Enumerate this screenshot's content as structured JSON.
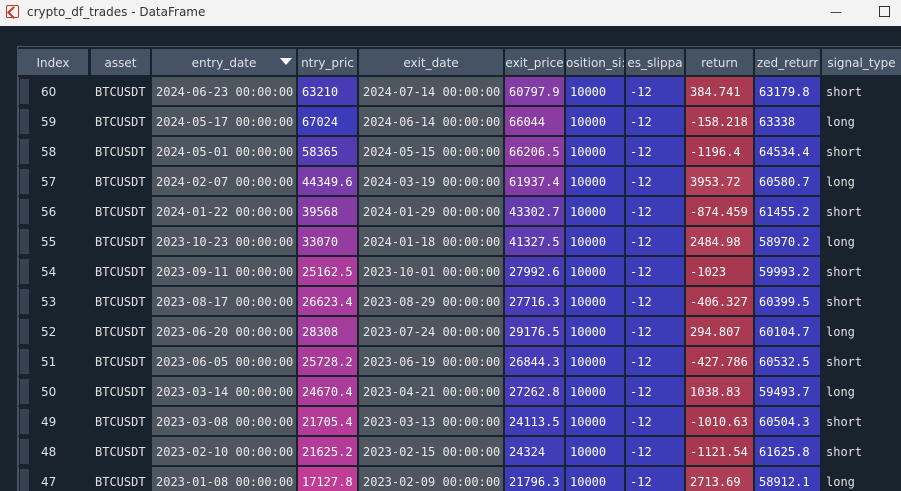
{
  "window": {
    "title": "crypto_df_trades - DataFrame",
    "minimize_label": "—"
  },
  "columns": [
    {
      "key": "index",
      "label": "Index"
    },
    {
      "key": "asset",
      "label": "asset"
    },
    {
      "key": "entry_date",
      "label": "entry_date",
      "sort": "descending"
    },
    {
      "key": "entry_price",
      "label": "ntry_pric"
    },
    {
      "key": "exit_date",
      "label": "exit_date"
    },
    {
      "key": "exit_price",
      "label": "exit_price"
    },
    {
      "key": "position_size",
      "label": "osition_si:"
    },
    {
      "key": "slippage",
      "label": "es_slippa"
    },
    {
      "key": "return",
      "label": "return"
    },
    {
      "key": "cum_return",
      "label": "zed_returr"
    },
    {
      "key": "signal_type",
      "label": "signal_type"
    }
  ],
  "rows": [
    {
      "index": "60",
      "asset": "BTCUSDT",
      "entry_date": "2024-06-23 00:00:00",
      "entry_price": "63210",
      "exit_date": "2024-07-14 00:00:00",
      "exit_price": "60797.9",
      "position_size": "10000",
      "slippage": "-12",
      "return": "384.741",
      "cum_return": "63179.8",
      "signal_type": "short"
    },
    {
      "index": "59",
      "asset": "BTCUSDT",
      "entry_date": "2024-05-17 00:00:00",
      "entry_price": "67024",
      "exit_date": "2024-06-14 00:00:00",
      "exit_price": "66044",
      "position_size": "10000",
      "slippage": "-12",
      "return": "-158.218",
      "cum_return": "63338",
      "signal_type": "long"
    },
    {
      "index": "58",
      "asset": "BTCUSDT",
      "entry_date": "2024-05-01 00:00:00",
      "entry_price": "58365",
      "exit_date": "2024-05-15 00:00:00",
      "exit_price": "66206.5",
      "position_size": "10000",
      "slippage": "-12",
      "return": "-1196.4",
      "cum_return": "64534.4",
      "signal_type": "short"
    },
    {
      "index": "57",
      "asset": "BTCUSDT",
      "entry_date": "2024-02-07 00:00:00",
      "entry_price": "44349.6",
      "exit_date": "2024-03-19 00:00:00",
      "exit_price": "61937.4",
      "position_size": "10000",
      "slippage": "-12",
      "return": "3953.72",
      "cum_return": "60580.7",
      "signal_type": "long"
    },
    {
      "index": "56",
      "asset": "BTCUSDT",
      "entry_date": "2024-01-22 00:00:00",
      "entry_price": "39568",
      "exit_date": "2024-01-29 00:00:00",
      "exit_price": "43302.7",
      "position_size": "10000",
      "slippage": "-12",
      "return": "-874.459",
      "cum_return": "61455.2",
      "signal_type": "short"
    },
    {
      "index": "55",
      "asset": "BTCUSDT",
      "entry_date": "2023-10-23 00:00:00",
      "entry_price": "33070",
      "exit_date": "2024-01-18 00:00:00",
      "exit_price": "41327.5",
      "position_size": "10000",
      "slippage": "-12",
      "return": "2484.98",
      "cum_return": "58970.2",
      "signal_type": "long"
    },
    {
      "index": "54",
      "asset": "BTCUSDT",
      "entry_date": "2023-09-11 00:00:00",
      "entry_price": "25162.5",
      "exit_date": "2023-10-01 00:00:00",
      "exit_price": "27992.6",
      "position_size": "10000",
      "slippage": "-12",
      "return": "-1023",
      "cum_return": "59993.2",
      "signal_type": "short"
    },
    {
      "index": "53",
      "asset": "BTCUSDT",
      "entry_date": "2023-08-17 00:00:00",
      "entry_price": "26623.4",
      "exit_date": "2023-08-29 00:00:00",
      "exit_price": "27716.3",
      "position_size": "10000",
      "slippage": "-12",
      "return": "-406.327",
      "cum_return": "60399.5",
      "signal_type": "short"
    },
    {
      "index": "52",
      "asset": "BTCUSDT",
      "entry_date": "2023-06-20 00:00:00",
      "entry_price": "28308",
      "exit_date": "2023-07-24 00:00:00",
      "exit_price": "29176.5",
      "position_size": "10000",
      "slippage": "-12",
      "return": "294.807",
      "cum_return": "60104.7",
      "signal_type": "long"
    },
    {
      "index": "51",
      "asset": "BTCUSDT",
      "entry_date": "2023-06-05 00:00:00",
      "entry_price": "25728.2",
      "exit_date": "2023-06-19 00:00:00",
      "exit_price": "26844.3",
      "position_size": "10000",
      "slippage": "-12",
      "return": "-427.786",
      "cum_return": "60532.5",
      "signal_type": "short"
    },
    {
      "index": "50",
      "asset": "BTCUSDT",
      "entry_date": "2023-03-14 00:00:00",
      "entry_price": "24670.4",
      "exit_date": "2023-04-21 00:00:00",
      "exit_price": "27262.8",
      "position_size": "10000",
      "slippage": "-12",
      "return": "1038.83",
      "cum_return": "59493.7",
      "signal_type": "long"
    },
    {
      "index": "49",
      "asset": "BTCUSDT",
      "entry_date": "2023-03-08 00:00:00",
      "entry_price": "21705.4",
      "exit_date": "2023-03-13 00:00:00",
      "exit_price": "24113.5",
      "position_size": "10000",
      "slippage": "-12",
      "return": "-1010.63",
      "cum_return": "60504.3",
      "signal_type": "short"
    },
    {
      "index": "48",
      "asset": "BTCUSDT",
      "entry_date": "2023-02-10 00:00:00",
      "entry_price": "21625.2",
      "exit_date": "2023-02-15 00:00:00",
      "exit_price": "24324",
      "position_size": "10000",
      "slippage": "-12",
      "return": "-1121.54",
      "cum_return": "61625.8",
      "signal_type": "short"
    },
    {
      "index": "47",
      "asset": "BTCUSDT",
      "entry_date": "2023-01-08 00:00:00",
      "entry_price": "17127.8",
      "exit_date": "2023-02-09 00:00:00",
      "exit_price": "21796.3",
      "position_size": "10000",
      "slippage": "-12",
      "return": "2713.69",
      "cum_return": "58912.1",
      "signal_type": "long"
    }
  ],
  "colors": {
    "background": "#19232d",
    "header": "#455364",
    "text_column": "#4e5660",
    "numeric_low": "#3c3cb8",
    "numeric_high": "#c03c95",
    "return_column": "#b83c5a"
  }
}
